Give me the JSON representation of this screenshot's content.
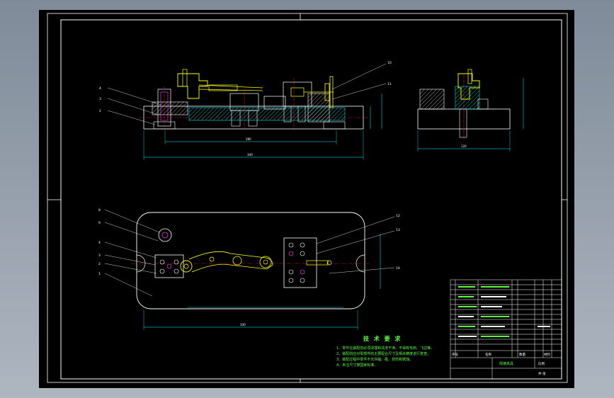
{
  "balloons_front": [
    "4",
    "3",
    "2"
  ],
  "balloons_front_right": [
    "10",
    "11"
  ],
  "balloons_top": [
    "8",
    "9",
    "4",
    "3",
    "2",
    "1"
  ],
  "balloons_top_right": [
    "12",
    "13",
    "14"
  ],
  "dimensions": {
    "front_inner": "280",
    "front_overall": "340",
    "side_width": "120",
    "top_overall": "340"
  },
  "tech_title": "技 术 要 求",
  "tech_lines": [
    "1、零件在装配前必须清理和清洗干净，不得有毛刺、飞边等。",
    "2、装配前应对零部件的主要配合尺寸及相关精度进行复查。",
    "3、装配过程中零件不允许磕、碰、划伤和锈蚀。",
    "4、未注尺寸按国家标准。"
  ],
  "title_block": {
    "drawing_name": "焊接夹具",
    "header_no": "序号",
    "header_name": "名称",
    "header_qty": "数量",
    "header_material": "材料",
    "ratio": "比例",
    "sheet": "共 张"
  },
  "colors": {
    "line": "#ffffff",
    "green": "#5cff3c",
    "yellow": "#ffff00",
    "cyan": "#00ffff",
    "red": "#ff2020",
    "magenta": "#ff40ff"
  }
}
